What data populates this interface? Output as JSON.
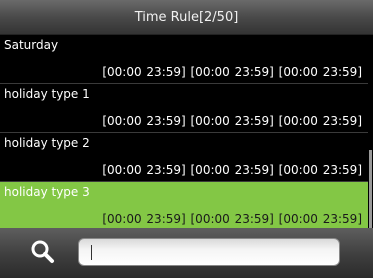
{
  "header": {
    "title": "Time Rule[2/50]"
  },
  "rules": [
    {
      "name": "Saturday",
      "periods": "[00:00 23:59] [00:00 23:59] [00:00 23:59]"
    },
    {
      "name": "holiday type 1",
      "periods": "[00:00 23:59] [00:00 23:59] [00:00 23:59]"
    },
    {
      "name": "holiday type 2",
      "periods": "[00:00 23:59] [00:00 23:59] [00:00 23:59]"
    },
    {
      "name": "holiday type 3",
      "periods": "[00:00 23:59] [00:00 23:59] [00:00 23:59]",
      "selected": true
    }
  ],
  "search": {
    "value": "",
    "icon": "search-icon"
  },
  "colors": {
    "selected_row": "#83c745",
    "background": "#000000"
  }
}
